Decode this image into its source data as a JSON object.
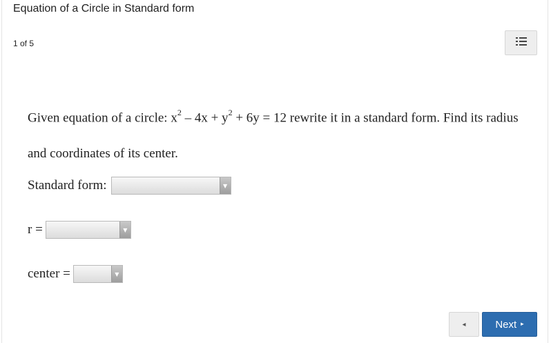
{
  "header": {
    "title": "Equation of a Circle in Standard form",
    "counter": "1 of 5",
    "menu_icon": "list-icon"
  },
  "question": {
    "prefix": "Given equation of a circle: x",
    "sup1": "2",
    "mid1": " – 4x + y",
    "sup2": "2",
    "rest": " + 6y = 12 rewrite it in a standard form. Find its radius and coordinates of its center."
  },
  "fields": {
    "standard_form_label": "Standard form:",
    "r_label": "r =",
    "center_label": "center ="
  },
  "footer": {
    "prev_icon": "◂",
    "next_label": "Next",
    "next_icon": "▸"
  }
}
